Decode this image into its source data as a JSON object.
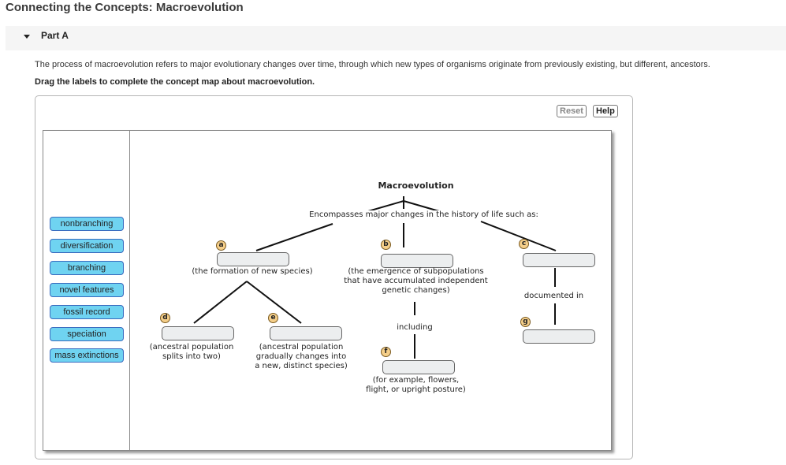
{
  "page": {
    "title": "Connecting the Concepts: Macroevolution",
    "part_label": "Part A",
    "intro": "The process of macroevolution refers to major evolutionary changes over time, through which new types of organisms originate from previously existing, but different, ancestors.",
    "instructions": "Drag the labels to complete the concept map about macroevolution."
  },
  "toolbar": {
    "reset_label": "Reset",
    "help_label": "Help"
  },
  "labels": [
    "nonbranching",
    "diversification",
    "branching",
    "novel features",
    "fossil record",
    "speciation",
    "mass extinctions"
  ],
  "map": {
    "root": "Macroevolution",
    "root_link": "Encompasses major changes in the history of life such as:",
    "targets": {
      "a": {
        "badge": "a",
        "caption": "(the formation of new species)"
      },
      "b": {
        "badge": "b",
        "caption_lines": [
          "(the emergence of subpopulations",
          "that have accumulated independent",
          "genetic changes)"
        ]
      },
      "c": {
        "badge": "c"
      },
      "d": {
        "badge": "d",
        "caption_lines": [
          "(ancestral population",
          "splits into two)"
        ]
      },
      "e": {
        "badge": "e",
        "caption_lines": [
          "(ancestral population",
          "gradually changes into",
          "a new, distinct species)"
        ]
      },
      "f": {
        "badge": "f",
        "caption_lines": [
          "(for example, flowers,",
          "flight, or upright posture)"
        ]
      },
      "g": {
        "badge": "g"
      }
    },
    "link_including": "including",
    "link_documented": "documented in"
  },
  "colors": {
    "label_fill": "#6fd3f1",
    "label_border": "#3a6bbf",
    "badge_fill": "#f5cf8a",
    "dropzone_fill": "#eceeef"
  }
}
